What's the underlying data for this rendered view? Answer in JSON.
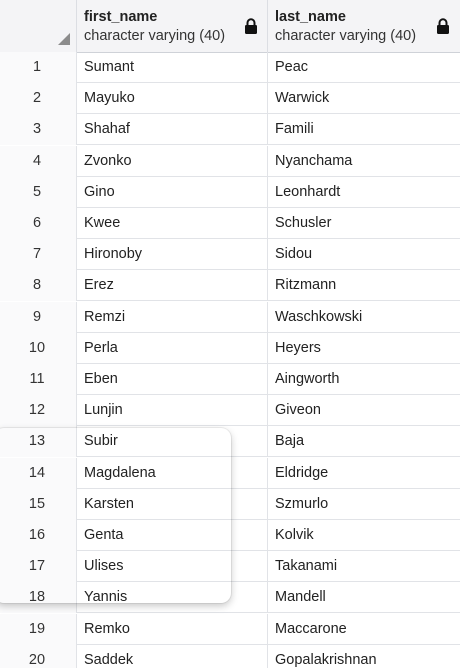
{
  "columns": [
    {
      "name": "first_name",
      "type": "character varying (40)",
      "locked_icon": "lock-icon"
    },
    {
      "name": "last_name",
      "type": "character varying (40)",
      "locked_icon": "lock-icon"
    }
  ],
  "rows": [
    {
      "n": "1",
      "first_name": "Sumant",
      "last_name": "Peac"
    },
    {
      "n": "2",
      "first_name": "Mayuko",
      "last_name": "Warwick"
    },
    {
      "n": "3",
      "first_name": "Shahaf",
      "last_name": "Famili"
    },
    {
      "n": "4",
      "first_name": "Zvonko",
      "last_name": "Nyanchama"
    },
    {
      "n": "5",
      "first_name": "Gino",
      "last_name": "Leonhardt"
    },
    {
      "n": "6",
      "first_name": "Kwee",
      "last_name": "Schusler"
    },
    {
      "n": "7",
      "first_name": "Hironoby",
      "last_name": "Sidou"
    },
    {
      "n": "8",
      "first_name": "Erez",
      "last_name": "Ritzmann"
    },
    {
      "n": "9",
      "first_name": "Remzi",
      "last_name": "Waschkowski"
    },
    {
      "n": "10",
      "first_name": "Perla",
      "last_name": "Heyers"
    },
    {
      "n": "11",
      "first_name": "Eben",
      "last_name": "Aingworth"
    },
    {
      "n": "12",
      "first_name": "Lunjin",
      "last_name": "Giveon"
    },
    {
      "n": "13",
      "first_name": "Subir",
      "last_name": "Baja"
    },
    {
      "n": "14",
      "first_name": "Magdalena",
      "last_name": "Eldridge"
    },
    {
      "n": "15",
      "first_name": "Karsten",
      "last_name": "Szmurlo"
    },
    {
      "n": "16",
      "first_name": "Genta",
      "last_name": "Kolvik"
    },
    {
      "n": "17",
      "first_name": "Ulises",
      "last_name": "Takanami"
    },
    {
      "n": "18",
      "first_name": "Yannis",
      "last_name": "Mandell"
    },
    {
      "n": "19",
      "first_name": "Remko",
      "last_name": "Maccarone"
    },
    {
      "n": "20",
      "first_name": "Saddek",
      "last_name": "Gopalakrishnan"
    }
  ],
  "colors": {
    "accent": "#4a6fd0",
    "header_bg": "#f4f4f6",
    "grid_line": "#e1e3e7"
  }
}
